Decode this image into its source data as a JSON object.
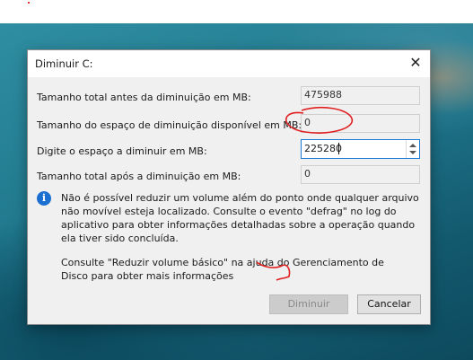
{
  "dialog": {
    "title": "Diminuir C:",
    "close_glyph": "✕",
    "rows": [
      {
        "label": "Tamanho total antes da diminuição em MB:",
        "value": "475988"
      },
      {
        "label": "Tamanho do espaço de diminuição disponível em MB:",
        "value": "0"
      },
      {
        "label": "Digite o espaço a diminuir em MB:",
        "value": "225280"
      },
      {
        "label": "Tamanho total após a diminuição em MB:",
        "value": "0"
      }
    ],
    "info_text": "Não é possível reduzir um volume além do ponto onde qualquer arquivo não movível esteja localizado. Consulte o evento \"defrag\" no log do aplicativo para obter informações detalhadas sobre a operação quando ela tiver sido concluída.",
    "help_text": "Consulte \"Reduzir volume básico\" na ajuda do Gerenciamento de Disco para obter mais informações",
    "buttons": {
      "diminuir": "Diminuir",
      "cancelar": "Cancelar"
    },
    "info_icon": "information-icon",
    "colors": {
      "accent": "#1e7bd4",
      "annotation": "#e02020"
    }
  }
}
